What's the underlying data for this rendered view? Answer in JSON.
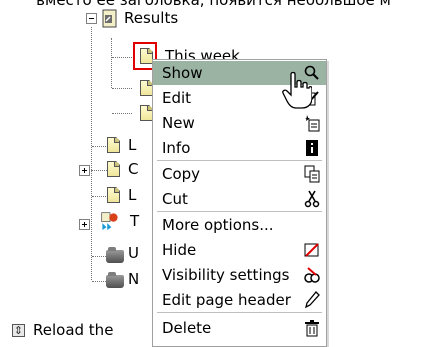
{
  "caption": "вместо ее заголовка, появится небольшое м",
  "tree": {
    "root_label": "Results",
    "items": [
      {
        "label": "This week"
      },
      {
        "label": "L"
      },
      {
        "label": "C"
      },
      {
        "label": "L"
      },
      {
        "label": "T"
      },
      {
        "label": "U"
      },
      {
        "label": "N"
      }
    ],
    "reload_label": "Reload the"
  },
  "context_menu": {
    "items": [
      {
        "label": "Show",
        "icon": "magnifier-icon",
        "highlight": true
      },
      {
        "label": "Edit",
        "icon": "edit-icon"
      },
      {
        "label": "New",
        "icon": "new-icon"
      },
      {
        "label": "Info",
        "icon": "info-icon"
      },
      {
        "label": "Copy",
        "icon": "copy-icon"
      },
      {
        "label": "Cut",
        "icon": "scissors-icon"
      },
      {
        "label": "More options...",
        "icon": ""
      },
      {
        "label": "Hide",
        "icon": "hide-icon"
      },
      {
        "label": "Visibility settings",
        "icon": "visibility-icon"
      },
      {
        "label": "Edit page header",
        "icon": "edit-header-icon"
      },
      {
        "label": "Delete",
        "icon": "trash-icon"
      }
    ]
  },
  "colors": {
    "highlight": "#9ab3a3",
    "selection_border": "#e00000"
  }
}
